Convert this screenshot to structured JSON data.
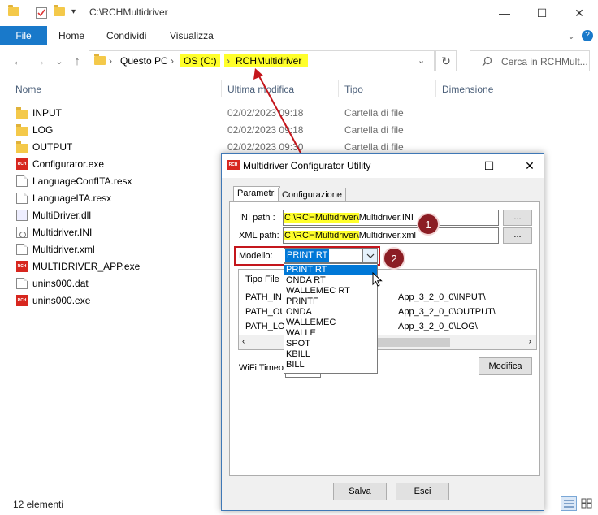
{
  "window": {
    "path_title": "C:\\RCHMultidriver",
    "minimize": "—",
    "maximize": "☐",
    "close": "✕"
  },
  "ribbon": {
    "file": "File",
    "tabs": [
      "Home",
      "Condividi",
      "Visualizza"
    ],
    "expand": "⌄",
    "help": "?"
  },
  "address": {
    "back": "←",
    "forward": "→",
    "recent": "⌄",
    "up": "↑",
    "crumbs": [
      "Questo PC",
      "OS (C:)",
      "RCHMultidriver"
    ],
    "separator": "›",
    "dropdown": "⌄",
    "refresh": "↻",
    "search_placeholder": "Cerca in RCHMult..."
  },
  "columns": [
    "Nome",
    "Ultima modifica",
    "Tipo",
    "Dimensione"
  ],
  "files": [
    {
      "name": "INPUT",
      "icon": "folder-icon",
      "date": "02/02/2023 09:18",
      "type": "Cartella di file"
    },
    {
      "name": "LOG",
      "icon": "folder-icon",
      "date": "02/02/2023 09:18",
      "type": "Cartella di file"
    },
    {
      "name": "OUTPUT",
      "icon": "folder-icon",
      "date": "02/02/2023 09:30",
      "type": "Cartella di file"
    },
    {
      "name": "Configurator.exe",
      "icon": "rch-exe-icon",
      "date": "",
      "type": ""
    },
    {
      "name": "LanguageConfITA.resx",
      "icon": "document-icon",
      "date": "",
      "type": ""
    },
    {
      "name": "LanguageITA.resx",
      "icon": "document-icon",
      "date": "",
      "type": ""
    },
    {
      "name": "MultiDriver.dll",
      "icon": "dll-icon",
      "date": "",
      "type": ""
    },
    {
      "name": "Multidriver.INI",
      "icon": "ini-icon",
      "date": "",
      "type": ""
    },
    {
      "name": "Multidriver.xml",
      "icon": "document-icon",
      "date": "",
      "type": ""
    },
    {
      "name": "MULTIDRIVER_APP.exe",
      "icon": "rch-exe-icon",
      "date": "",
      "type": ""
    },
    {
      "name": "unins000.dat",
      "icon": "document-icon",
      "date": "",
      "type": ""
    },
    {
      "name": "unins000.exe",
      "icon": "rch-exe-icon",
      "date": "",
      "type": ""
    }
  ],
  "status": "12 elementi",
  "dialog": {
    "title": "Multidriver Configurator Utility",
    "app_icon_text": "RCH",
    "tabs": [
      "Parametri",
      "Configurazione"
    ],
    "ini_label": "INI path :",
    "ini_value_hl": "C:\\RCHMultidriver\\",
    "ini_value_rest": "Multidriver.INI",
    "xml_label": "XML path:",
    "xml_value_hl": "C:\\RCHMultidriver\\",
    "xml_value_rest": "Multidriver.xml",
    "browse": "...",
    "model_label": "Modello:",
    "model_selected": "PRINT RT",
    "model_options": [
      "PRINT RT",
      "ONDA RT",
      "WALLEMEC RT",
      "PRINTF",
      "ONDA",
      "WALLEMEC",
      "WALLE",
      "SPOT",
      "KBILL",
      "BILL"
    ],
    "grid_header": "Tipo File",
    "grid_rows": [
      {
        "left": "PATH_IN",
        "right": "App_3_2_0_0\\INPUT\\"
      },
      {
        "left": "PATH_OU",
        "right": "App_3_2_0_0\\OUTPUT\\"
      },
      {
        "left": "PATH_LO",
        "right": "App_3_2_0_0\\LOG\\"
      }
    ],
    "wifi_label": "WiFi Timeo",
    "modify": "Modifica",
    "save": "Salva",
    "exit": "Esci"
  },
  "callouts": [
    "1",
    "2"
  ],
  "colors": {
    "highlight": "#ffff2b",
    "accent": "#1979ca",
    "annotation": "#c4161c"
  }
}
